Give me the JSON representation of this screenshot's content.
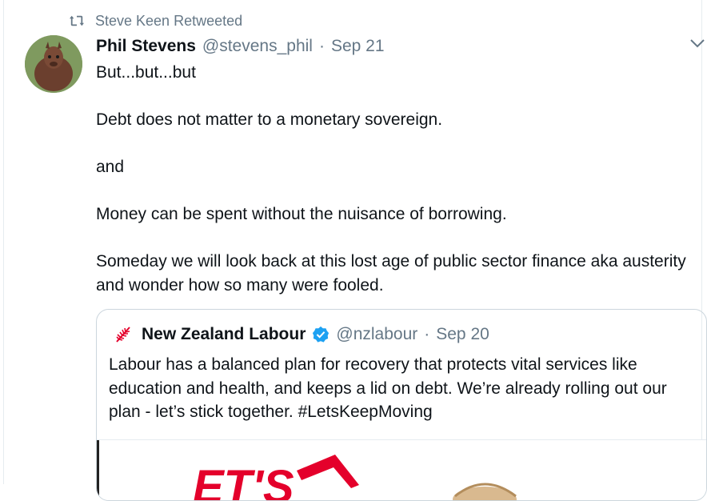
{
  "retweet": {
    "label": "Steve Keen Retweeted",
    "icon": "retweet-icon"
  },
  "tweet": {
    "author_name": "Phil Stevens",
    "author_handle": "@stevens_phil",
    "separator": "·",
    "date": "Sep 21",
    "lines": [
      "But...but...but",
      "",
      "Debt does not matter to a monetary sovereign.",
      "",
      "and",
      "",
      "Money can be spent without the nuisance of borrowing.",
      "",
      "Someday we will look back at this lost age of public sector finance aka austerity and wonder how so many were fooled."
    ]
  },
  "quoted_tweet": {
    "author_name": "New Zealand Labour",
    "author_handle": "@nzlabour",
    "separator": "·",
    "date": "Sep 20",
    "text": "Labour has a balanced plan for recovery that protects vital services like education and health, and keeps a lid on debt. We’re already rolling out our plan - let’s stick together. #LetsKeepMoving",
    "media_text": "ET'S"
  },
  "colors": {
    "accent": "#1da1f2",
    "muted": "#657786",
    "brand_red": "#e4002b"
  }
}
